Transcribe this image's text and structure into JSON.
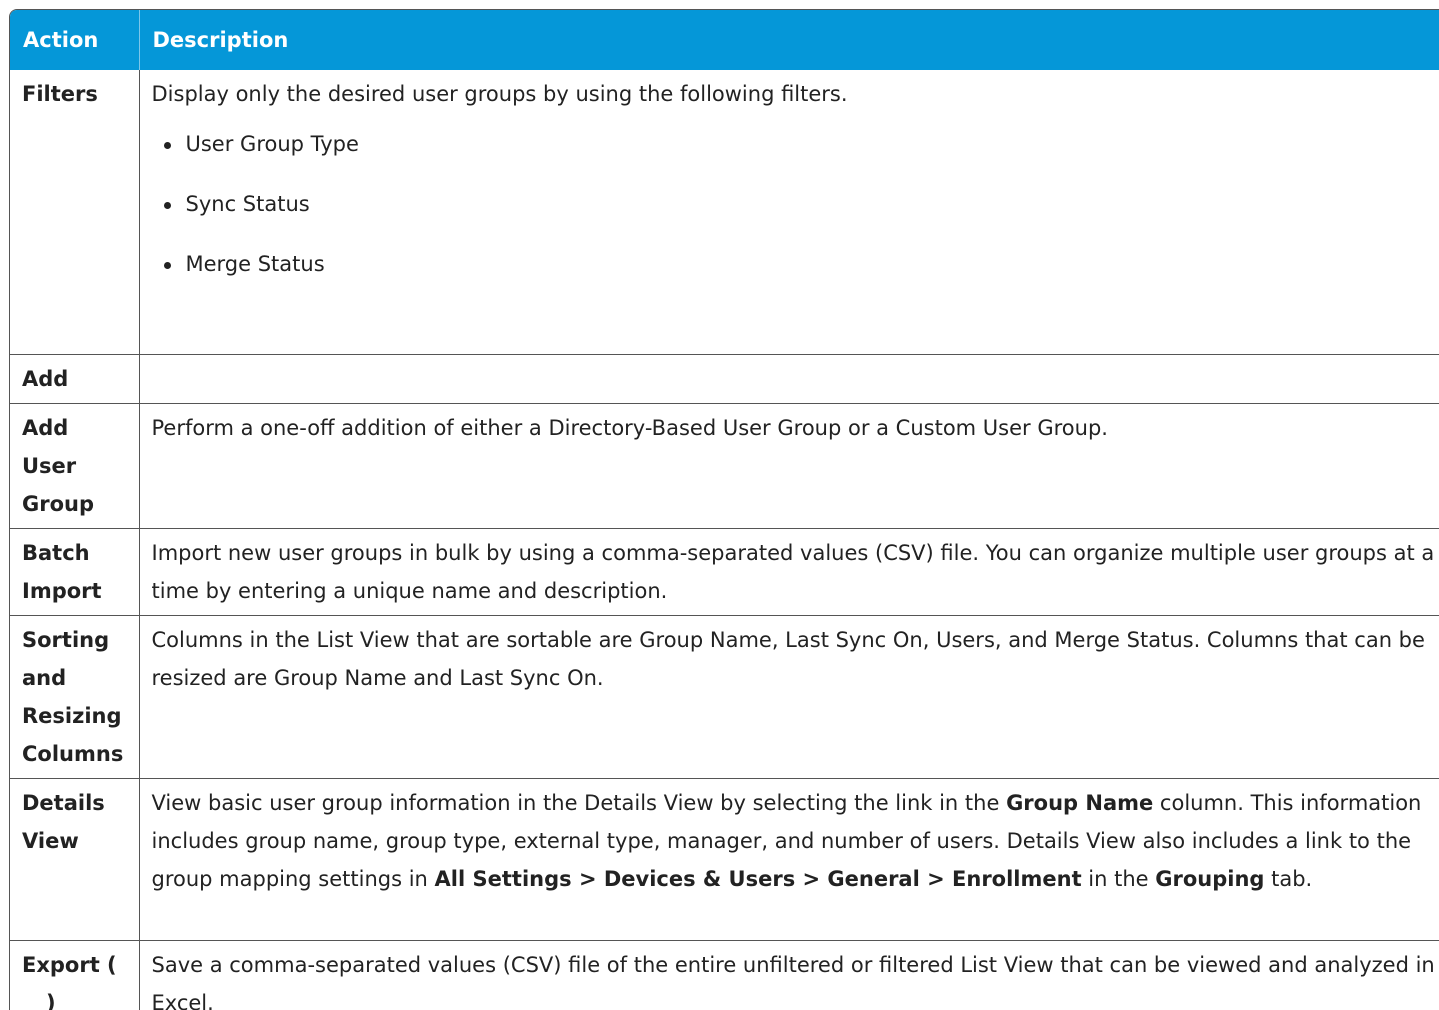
{
  "header": {
    "action": "Action",
    "description": "Description"
  },
  "rows": {
    "filters": {
      "action": "Filters",
      "description": "Display only the desired user groups by using the following filters.",
      "bullets": [
        "User Group Type",
        "Sync Status",
        "Merge Status"
      ]
    },
    "add": {
      "action": "Add"
    },
    "add_user_group": {
      "action_lines": [
        "Add",
        "User",
        "Group"
      ],
      "description": "Perform a one-off addition of either a Directory-Based User Group or a Custom User Group."
    },
    "batch_import": {
      "action_lines": [
        "Batch",
        "Import"
      ],
      "description": "Import new user groups in bulk by using a comma-separated values (CSV) file. You can organize multiple user groups at a time by entering a unique name and description."
    },
    "sorting": {
      "action_lines": [
        "Sorting",
        "and",
        "Resizing",
        "Columns"
      ],
      "description": "Columns in the List View that are sortable are Group Name, Last Sync On, Users, and Merge Status. Columns that can be resized are Group Name and Last Sync On."
    },
    "details": {
      "action_lines": [
        "Details",
        "View"
      ],
      "desc_1": "View basic user group information in the Details View by selecting the link in the ",
      "desc_bold_1": "Group Name",
      "desc_2": " column. This information includes group name, group type, external type, manager, and number of users. Details View also includes a link to the group mapping settings in ",
      "desc_bold_2": "All Settings > Devices & Users > General > Enrollment",
      "desc_3": " in the ",
      "desc_bold_3": "Grouping",
      "desc_4": " tab."
    },
    "export": {
      "action_prefix": "Export (",
      "action_suffix": ")",
      "icon": "export-icon",
      "description": "Save a comma-separated values (CSV) file of the entire unfiltered or filtered List View that can be viewed and analyzed in Excel."
    }
  },
  "colors": {
    "header_bg": "#0597d8",
    "header_text": "#ffffff",
    "border": "#555555"
  }
}
